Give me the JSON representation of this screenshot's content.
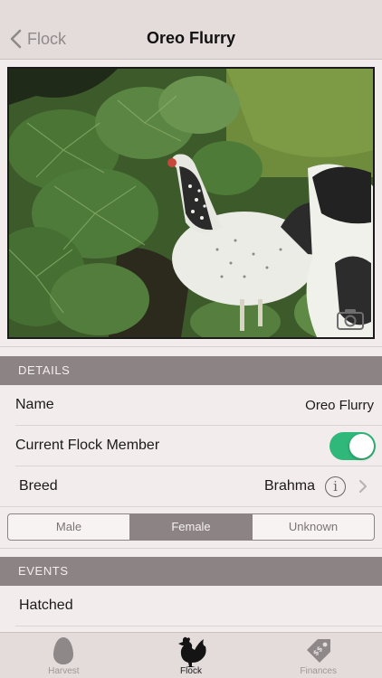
{
  "navbar": {
    "back_label": "Flock",
    "title": "Oreo Flurry"
  },
  "photo": {
    "description_icon": "camera-icon"
  },
  "details": {
    "header": "DETAILS",
    "name_label": "Name",
    "name_value": "Oreo Flurry",
    "member_label": "Current Flock Member",
    "member_on": true,
    "breed_label": "Breed",
    "breed_value": "Brahma",
    "info_glyph": "i",
    "sex_options": [
      "Male",
      "Female",
      "Unknown"
    ],
    "sex_selected": "Female"
  },
  "events": {
    "header": "EVENTS",
    "items": [
      {
        "label": "Hatched"
      }
    ]
  },
  "tabbar": {
    "tabs": [
      {
        "label": "Harvest",
        "icon": "egg-icon"
      },
      {
        "label": "Flock",
        "icon": "chicken-icon",
        "active": true
      },
      {
        "label": "Finances",
        "icon": "price-tag-icon"
      }
    ]
  },
  "colors": {
    "background": "#f3ecec",
    "bar": "#e4dbdb",
    "section_header": "#8c8484",
    "toggle_on": "#2fb87a"
  }
}
